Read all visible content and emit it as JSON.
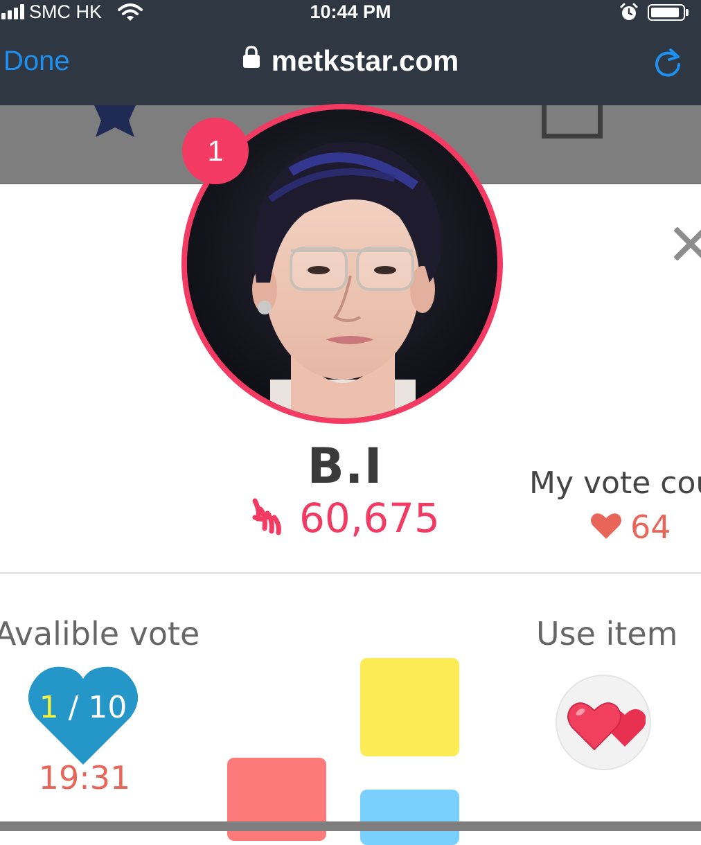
{
  "status_bar": {
    "carrier": "SMC HK",
    "time": "10:44 PM",
    "signal_icon": "cellular-signal-icon",
    "wifi_icon": "wifi-icon",
    "alarm_icon": "alarm-clock-icon",
    "battery_icon": "battery-icon"
  },
  "browser": {
    "done_label": "Done",
    "url": "metkstar.com",
    "lock_icon": "lock-icon",
    "reload_icon": "reload-icon",
    "accent_color": "#1e90f0"
  },
  "page_header": {
    "star_icon": "star-icon",
    "box_icon": "box-icon"
  },
  "modal": {
    "close_icon": "close-icon",
    "rank": "1",
    "artist": {
      "name": "B.I",
      "total_votes": "60,675",
      "votes_icon": "finger-heart-icon",
      "photo": "artist-photo"
    },
    "my_vote": {
      "label": "My vote cou",
      "value": "64",
      "icon": "heart-icon"
    },
    "available_vote": {
      "label": "Avalible vote",
      "current": "1",
      "separator": "/",
      "max": "10",
      "timer": "19:31",
      "icon": "heart-icon"
    },
    "use_item": {
      "label": "Use item",
      "icon": "double-heart-icon"
    },
    "colors": {
      "brand": "#f23a63",
      "vote_value": "#e8655a",
      "heart_blue": "#2596c8",
      "tile_yellow": "#fdeb55",
      "tile_coral": "#fd7a7a",
      "tile_blue": "#7ad0fd"
    }
  }
}
